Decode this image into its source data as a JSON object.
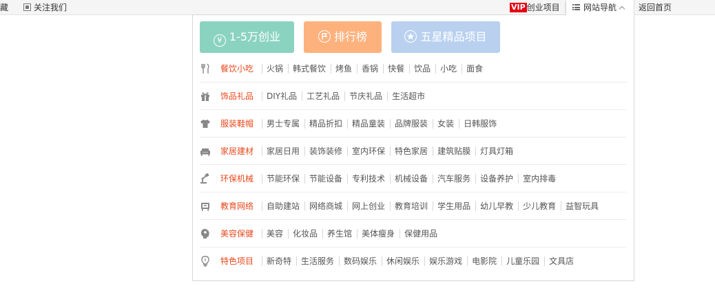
{
  "topbar": {
    "fav": "藏",
    "follow": "关注我们",
    "vip_badge": "VIP",
    "vip_label": "创业项目",
    "nav_label": "网站导航",
    "home": "返回首页"
  },
  "buttons": [
    {
      "label": "1-5万创业",
      "color": "#8bd3c1",
      "icon": "yen-circle-icon"
    },
    {
      "label": "排行榜",
      "color": "#fdb27e",
      "icon": "flag-circle-icon"
    },
    {
      "label": "五星精品项目",
      "color": "#b9d1ef",
      "icon": "star-circle-icon"
    }
  ],
  "categories": [
    {
      "title": "餐饮小吃",
      "icon": "utensils-icon",
      "items": [
        "火锅",
        "韩式餐饮",
        "烤鱼",
        "香锅",
        "快餐",
        "饮品",
        "小吃",
        "面食"
      ]
    },
    {
      "title": "饰品礼品",
      "icon": "gift-icon",
      "items": [
        "DIY礼品",
        "工艺礼品",
        "节庆礼品",
        "生活超市"
      ]
    },
    {
      "title": "服装鞋帽",
      "icon": "tshirt-icon",
      "items": [
        "男士专属",
        "精品折扣",
        "精品童装",
        "品牌服装",
        "女装",
        "日韩服饰"
      ]
    },
    {
      "title": "家居建材",
      "icon": "sofa-icon",
      "items": [
        "家居日用",
        "装饰装修",
        "室内环保",
        "特色家居",
        "建筑贴膜",
        "灯具灯箱"
      ]
    },
    {
      "title": "环保机械",
      "icon": "machine-icon",
      "items": [
        "节能环保",
        "节能设备",
        "专利技术",
        "机械设备",
        "汽车服务",
        "设备养护",
        "室内排毒"
      ]
    },
    {
      "title": "教育网络",
      "icon": "education-icon",
      "items": [
        "自助建站",
        "网络商城",
        "网上创业",
        "教育培训",
        "学生用品",
        "幼儿早教",
        "少儿教育",
        "益智玩具"
      ]
    },
    {
      "title": "美容保健",
      "icon": "beauty-icon",
      "items": [
        "美容",
        "化妆品",
        "养生馆",
        "美体瘦身",
        "保健用品"
      ]
    },
    {
      "title": "特色项目",
      "icon": "lightbulb-icon",
      "items": [
        "新奇特",
        "生活服务",
        "数码娱乐",
        "休闲娱乐",
        "娱乐游戏",
        "电影院",
        "儿童乐园",
        "文具店"
      ]
    }
  ],
  "accent_color": "#e8491d"
}
